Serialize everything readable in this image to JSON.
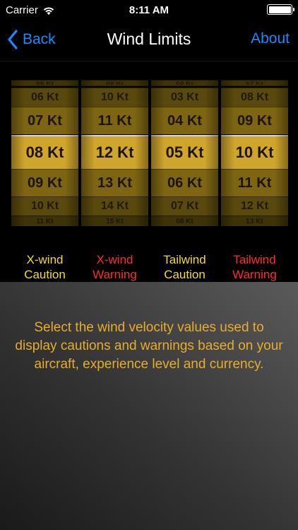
{
  "status_bar": {
    "carrier": "Carrier",
    "time": "8:11 AM"
  },
  "nav": {
    "back_label": "Back",
    "title": "Wind Limits",
    "about_label": "About"
  },
  "picker": {
    "columns": [
      {
        "values": [
          "05 Kt",
          "06 Kt",
          "07 Kt",
          "08 Kt",
          "09 Kt",
          "10 Kt",
          "11 Kt"
        ],
        "selected": "08 Kt",
        "label_line1": "X-wind",
        "label_line2": "Caution",
        "label_color": "#f2df2c"
      },
      {
        "values": [
          "09 Kt",
          "10 Kt",
          "11 Kt",
          "12 Kt",
          "13 Kt",
          "14 Kt",
          "15 Kt"
        ],
        "selected": "12 Kt",
        "label_line1": "X-wind",
        "label_line2": "Warning",
        "label_color": "#ff2d2d"
      },
      {
        "values": [
          "02 Kt",
          "03 Kt",
          "04 Kt",
          "05 Kt",
          "06 Kt",
          "07 Kt",
          "08 Kt"
        ],
        "selected": "05 Kt",
        "label_line1": "Tailwind",
        "label_line2": "Caution",
        "label_color": "#f2df2c"
      },
      {
        "values": [
          "07 Kt",
          "08 Kt",
          "09 Kt",
          "10 Kt",
          "11 Kt",
          "12 Kt",
          "13 Kt"
        ],
        "selected": "10 Kt",
        "label_line1": "Tailwind",
        "label_line2": "Warning",
        "label_color": "#ff2d2d"
      }
    ]
  },
  "info": {
    "text": "Select the wind velocity values used to display cautions and warnings based on your aircraft, experience level and currency."
  },
  "colors": {
    "accent": "#1a8bff",
    "caution": "#f2df2c",
    "warning": "#ff2d2d",
    "info_text": "#e8ad2c",
    "wheel_selected": "#cfa52b"
  }
}
